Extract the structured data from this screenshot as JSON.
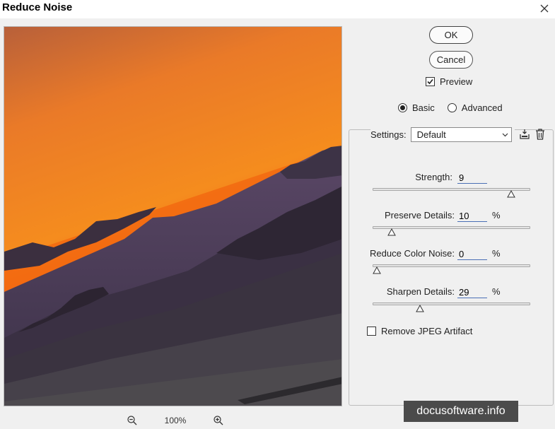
{
  "window": {
    "title": "Reduce Noise"
  },
  "buttons": {
    "ok_label": "OK",
    "cancel_label": "Cancel"
  },
  "preview_toggle": {
    "label": "Preview",
    "checked": true
  },
  "mode": {
    "basic_label": "Basic",
    "advanced_label": "Advanced",
    "selected": "basic"
  },
  "settings": {
    "label": "Settings:",
    "value": "Default"
  },
  "params": [
    {
      "label": "Strength:",
      "value": "9",
      "unit": "",
      "max": 10
    },
    {
      "label": "Preserve Details:",
      "value": "10",
      "unit": "%",
      "max": 100
    },
    {
      "label": "Reduce Color Noise:",
      "value": "0",
      "unit": "%",
      "max": 100
    },
    {
      "label": "Sharpen Details:",
      "value": "29",
      "unit": "%",
      "max": 100
    }
  ],
  "jpeg_artifact": {
    "label": "Remove JPEG Artifact",
    "checked": false
  },
  "zoom": {
    "level": "100%"
  },
  "watermark": "docusoftware.info",
  "icons": {
    "close": "close-icon",
    "zoom_out": "zoom-out-icon",
    "zoom_in": "zoom-in-icon",
    "save_preset": "save-preset-icon",
    "delete_preset": "trash-icon",
    "dropdown": "chevron-down-icon"
  }
}
